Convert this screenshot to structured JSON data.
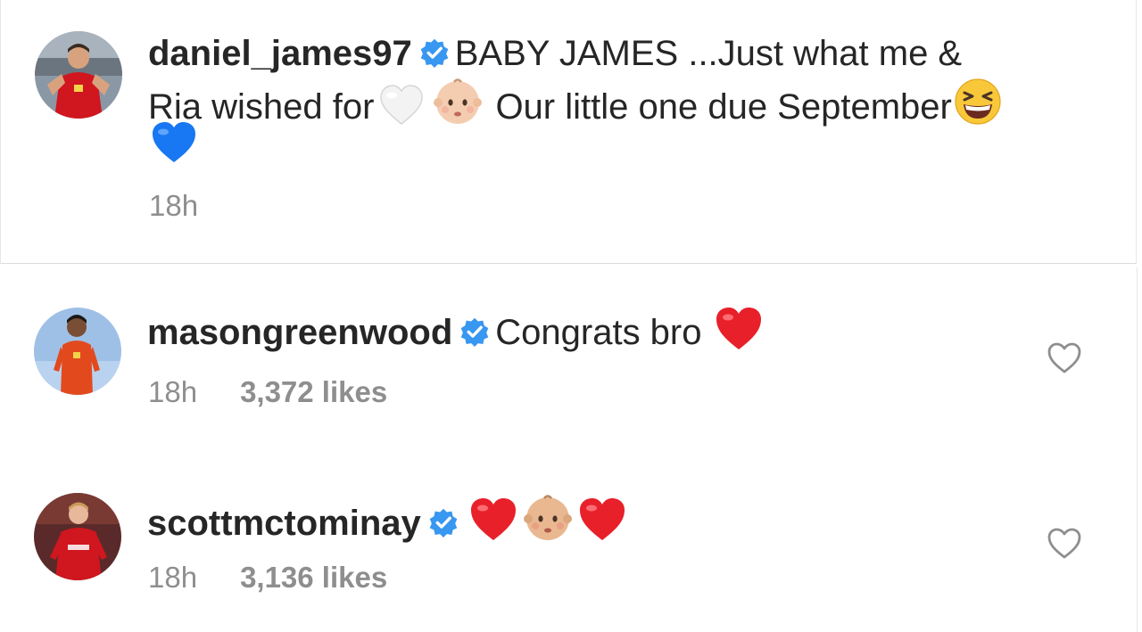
{
  "caption": {
    "username": "daniel_james97",
    "text_line1": "BABY JAMES ...Just what me &",
    "text_line2_a": "Ria wished for",
    "text_line2_b": "Our little one due September",
    "time": "18h",
    "icons": [
      "verified-badge-icon",
      "white-heart-emoji",
      "baby-emoji",
      "grinning-squinting-face-emoji",
      "blue-heart-emoji"
    ]
  },
  "comments": [
    {
      "username": "masongreenwood",
      "text": "Congrats bro",
      "time": "18h",
      "likes": "3,372 likes",
      "icons": [
        "verified-badge-icon",
        "red-heart-emoji",
        "heart-outline-icon"
      ]
    },
    {
      "username": "scottmctominay",
      "text": "",
      "time": "18h",
      "likes": "3,136 likes",
      "icons": [
        "verified-badge-icon",
        "red-heart-emoji",
        "baby-emoji",
        "red-heart-emoji",
        "heart-outline-icon"
      ]
    }
  ],
  "colors": {
    "text": "#262626",
    "secondary": "#8e8e8e",
    "verified": "#3897f0",
    "red_heart": "#e8202a",
    "blue_heart": "#1877f2"
  }
}
